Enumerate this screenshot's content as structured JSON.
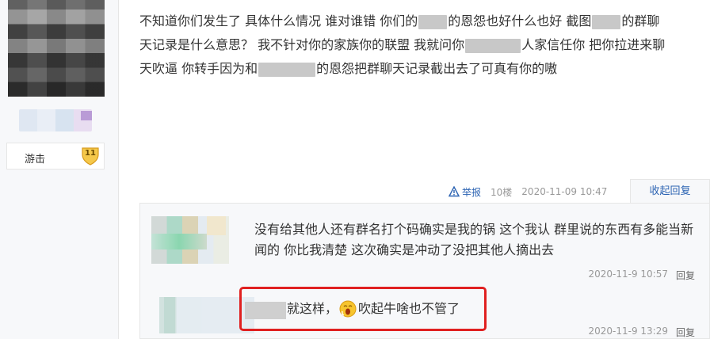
{
  "user": {
    "level_name": "游击",
    "level_number": "11"
  },
  "post": {
    "line1": [
      {
        "t": "text",
        "v": "不知道你们发生了 具体什么情况 谁对谁错 你们的"
      },
      {
        "t": "blur",
        "w": 36
      },
      {
        "t": "text",
        "v": "的恩怨也好什么也好 截图"
      },
      {
        "t": "blur",
        "w": 36
      },
      {
        "t": "text",
        "v": "的群聊"
      }
    ],
    "line2": [
      {
        "t": "text",
        "v": "天记录是什么意思？ 我不针对你的家族你的联盟 我就问你"
      },
      {
        "t": "blur",
        "w": 70
      },
      {
        "t": "text",
        "v": "人家信任你 把你拉进来聊"
      }
    ],
    "line3": [
      {
        "t": "text",
        "v": "天吹逼 你转手因为和"
      },
      {
        "t": "blur",
        "w": 72
      },
      {
        "t": "text",
        "v": "的恩怨把群聊天记录截出去了可真有你的嗷"
      }
    ]
  },
  "meta": {
    "report_label": "举报",
    "floor": "10楼",
    "time": "2020-11-09 10:47",
    "collapse_label": "收起回复"
  },
  "replies": [
    {
      "text": "没有给其他人还有群名打个码确实是我的锅 这个我认 群里说的东西有多能当新闻的 你比我清楚 这次确实是冲动了没把其他人摘出去",
      "time": "2020-11-9 10:57",
      "reply_label": "回复"
    },
    {
      "text_before": "就这样，",
      "emoji": "yawn-emoji",
      "text_after": "吹起牛啥也不管了",
      "time": "2020-11-9 13:29",
      "reply_label": "回复"
    }
  ],
  "colors": {
    "link": "#2d64b3",
    "highlight": "#e02020"
  }
}
